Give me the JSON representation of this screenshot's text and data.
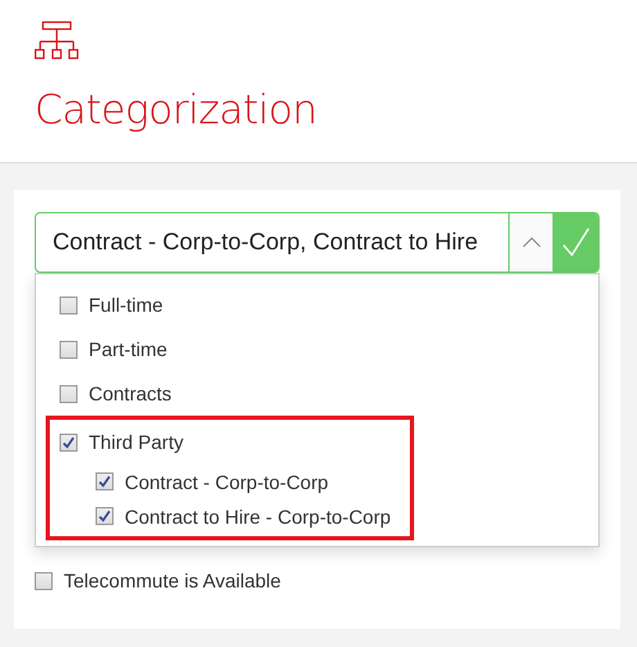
{
  "header": {
    "title": "Categorization"
  },
  "select": {
    "value": "Contract - Corp-to-Corp, Contract to Hire",
    "expanded": true,
    "valid": true,
    "options": [
      {
        "label": "Full-time",
        "checked": false,
        "highlighted": false
      },
      {
        "label": "Part-time",
        "checked": false,
        "highlighted": false
      },
      {
        "label": "Contracts",
        "checked": false,
        "highlighted": false
      },
      {
        "label": "Third Party",
        "checked": true,
        "highlighted": true,
        "children": [
          {
            "label": "Contract - Corp-to-Corp",
            "checked": true
          },
          {
            "label": "Contract to Hire - Corp-to-Corp",
            "checked": true
          }
        ]
      }
    ]
  },
  "telecommute": {
    "label": "Telecommute is Available",
    "checked": false
  }
}
